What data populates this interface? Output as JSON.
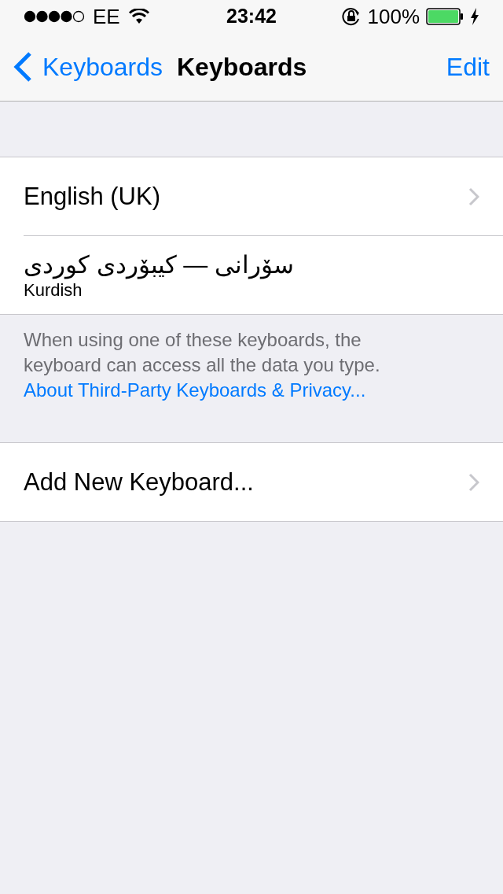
{
  "status_bar": {
    "carrier": "EE",
    "time": "23:42",
    "battery": "100%"
  },
  "nav": {
    "back": "Keyboards",
    "title": "Keyboards",
    "action": "Edit"
  },
  "keyboards": [
    {
      "name": "English (UK)",
      "chevron": true
    },
    {
      "name": "سۆرانی — کیبۆردی کوردی",
      "subtitle": "Kurdish",
      "chevron": false
    }
  ],
  "footer": {
    "note": "When using one of these keyboards, the keyboard can access all the data you type.",
    "link": "About Third-Party Keyboards & Privacy..."
  },
  "add_row": {
    "label": "Add New Keyboard...",
    "chevron": true
  }
}
